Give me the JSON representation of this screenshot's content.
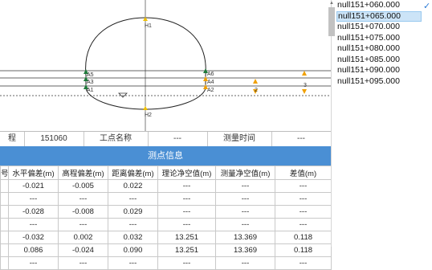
{
  "diagram": {
    "points_left": [
      "A5",
      "A3",
      "A1"
    ],
    "points_right": [
      "A6",
      "A4",
      "A2"
    ],
    "top_point": "H1",
    "bottom_point": "H2",
    "markers": [
      "2",
      "3"
    ]
  },
  "info": {
    "label1": "程",
    "value1": "151060",
    "label2": "工点名称",
    "value2": "---",
    "label3": "测量时间",
    "value3": "---"
  },
  "section_title": "测点信息",
  "table": {
    "headers": [
      "号",
      "水平偏差(m)",
      "高程偏差(m)",
      "距离偏差(m)",
      "理论净空值(m)",
      "测量净空值(m)",
      "差值(m)"
    ],
    "rows": [
      [
        "",
        "-0.021",
        "-0.005",
        "0.022",
        "---",
        "---",
        "---"
      ],
      [
        "",
        "---",
        "---",
        "---",
        "---",
        "---",
        "---"
      ],
      [
        "",
        "-0.028",
        "-0.008",
        "0.029",
        "---",
        "---",
        "---"
      ],
      [
        "",
        "---",
        "---",
        "---",
        "---",
        "---",
        "---"
      ],
      [
        "",
        "-0.032",
        "0.002",
        "0.032",
        "13.251",
        "13.369",
        "0.118"
      ],
      [
        "",
        "0.086",
        "-0.024",
        "0.090",
        "13.251",
        "13.369",
        "0.118"
      ],
      [
        "",
        "---",
        "---",
        "---",
        "---",
        "---",
        "---"
      ]
    ]
  },
  "sidebar": {
    "items": [
      {
        "label": "null151+060.000",
        "selected": false,
        "checked": true
      },
      {
        "label": "null151+065.000",
        "selected": true,
        "checked": false
      },
      {
        "label": "null151+070.000",
        "selected": false,
        "checked": false
      },
      {
        "label": "null151+075.000",
        "selected": false,
        "checked": false
      },
      {
        "label": "null151+080.000",
        "selected": false,
        "checked": false
      },
      {
        "label": "null151+085.000",
        "selected": false,
        "checked": false
      },
      {
        "label": "null151+090.000",
        "selected": false,
        "checked": false
      },
      {
        "label": "null151+095.000",
        "selected": false,
        "checked": false
      }
    ],
    "check_icon": "checkmark-icon"
  },
  "colors": {
    "header_blue": "#4a8fd4",
    "point_green": "#1f7a3a",
    "marker_orange": "#f0a000",
    "selection": "#cce4f7"
  }
}
